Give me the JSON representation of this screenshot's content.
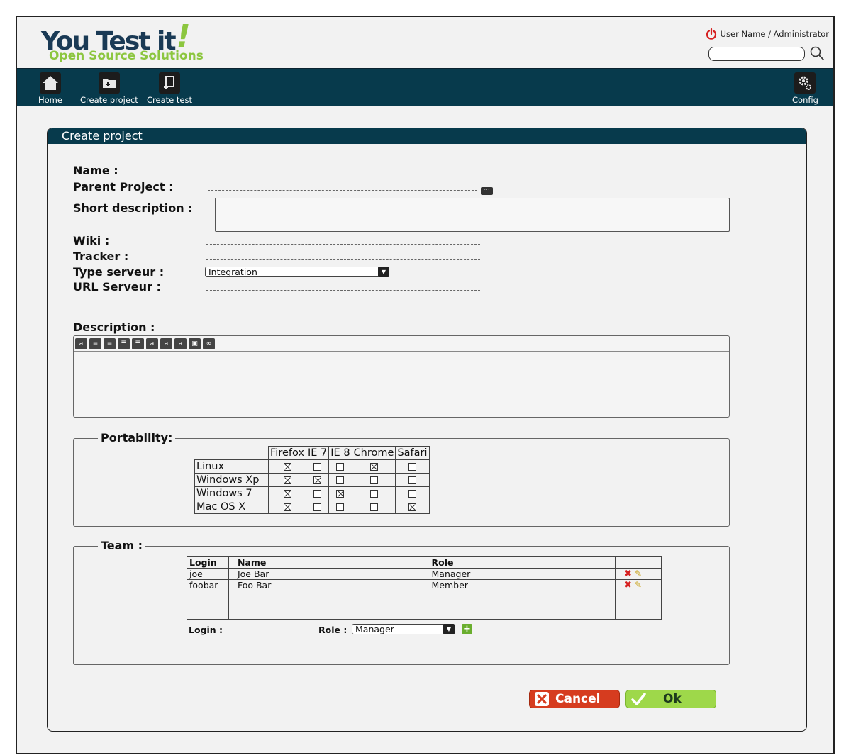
{
  "header": {
    "logo_main": "You Test it",
    "logo_bang": "!",
    "logo_sub": "Open Source Solutions",
    "user": "User Name / Administrator",
    "search_placeholder": ""
  },
  "nav": {
    "home": "Home",
    "create_project": "Create project",
    "create_test": "Create test",
    "config": "Config"
  },
  "panel": {
    "title": "Create project"
  },
  "form": {
    "name_label": "Name :",
    "parent_label": "Parent Project :",
    "short_desc_label": "Short description :",
    "wiki_label": "Wiki :",
    "tracker_label": "Tracker :",
    "type_label": "Type serveur :",
    "type_value": "Integration",
    "url_label": "URL Serveur :",
    "description_label": "Description :"
  },
  "portability": {
    "legend": "Portability:",
    "browsers": [
      "Firefox",
      "IE 7",
      "IE 8",
      "Chrome",
      "Safari"
    ],
    "rows": [
      {
        "os": "Linux",
        "checks": [
          true,
          false,
          false,
          true,
          false
        ]
      },
      {
        "os": "Windows Xp",
        "checks": [
          true,
          true,
          false,
          false,
          false
        ]
      },
      {
        "os": "Windows 7",
        "checks": [
          true,
          false,
          true,
          false,
          false
        ]
      },
      {
        "os": "Mac OS X",
        "checks": [
          true,
          false,
          false,
          false,
          true
        ]
      }
    ]
  },
  "team": {
    "legend": "Team :",
    "headers": {
      "login": "Login",
      "name": "Name",
      "role": "Role"
    },
    "members": [
      {
        "login": "joe",
        "name": "Joe Bar",
        "role": "Manager"
      },
      {
        "login": "foobar",
        "name": "Foo Bar",
        "role": "Member"
      }
    ],
    "login_label": "Login :",
    "role_label": "Role :",
    "role_value": "Manager"
  },
  "buttons": {
    "cancel": "Cancel",
    "ok": "Ok"
  },
  "colors": {
    "nav_bg": "#073a4c",
    "logo_blue": "#1a3a55",
    "logo_green": "#8cc63f",
    "cancel_red": "#d63c1f",
    "ok_green": "#9ed84a"
  }
}
